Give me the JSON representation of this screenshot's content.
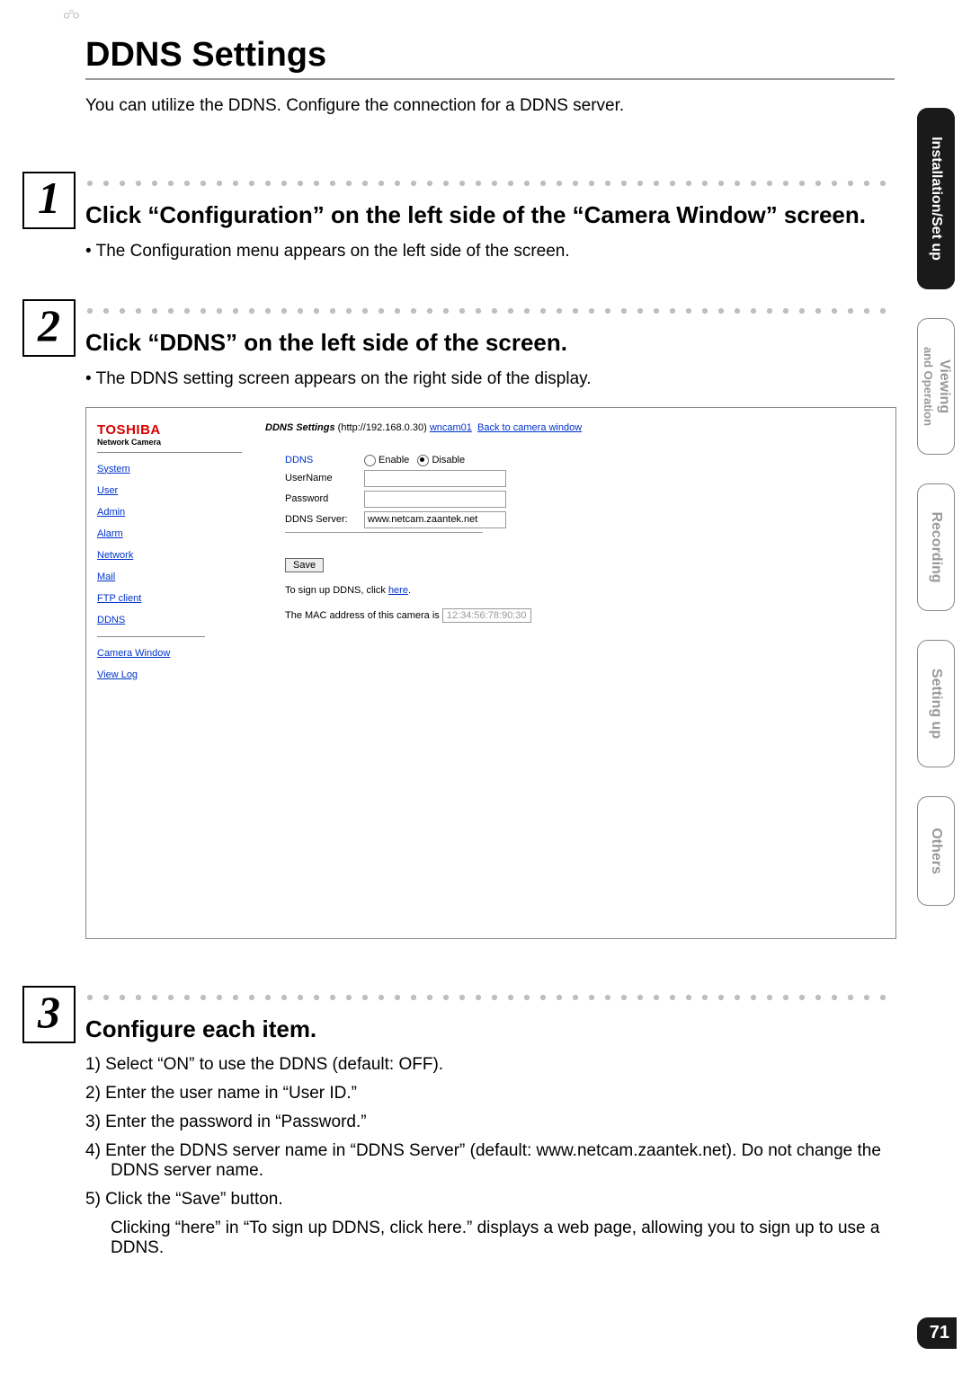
{
  "page_title": "DDNS Settings",
  "intro": "You can utilize the DDNS. Configure the connection for a DDNS server.",
  "page_number": "71",
  "side_tabs": {
    "t1": "Installation/Set up",
    "t2a": "Viewing",
    "t2b": "and Operation",
    "t3": "Recording",
    "t4": "Setting up",
    "t5": "Others"
  },
  "steps": {
    "s1": {
      "num": "1",
      "title": "Click “Configuration” on the left side of the “Camera Window” screen.",
      "bullet": "• The Configuration menu appears on the left side of the screen."
    },
    "s2": {
      "num": "2",
      "title": "Click “DDNS” on the left side of the screen.",
      "bullet": "• The DDNS setting screen appears on the right side of the display."
    },
    "s3": {
      "num": "3",
      "title": "Configure each item.",
      "i1": "1) Select “ON” to use the DDNS (default: OFF).",
      "i2": "2) Enter the user name in “User ID.”",
      "i3": "3) Enter the password in “Password.”",
      "i4": "4) Enter the DDNS server name in “DDNS Server” (default: www.netcam.zaantek.net). Do not change the DDNS server name.",
      "i5": "5) Click the “Save” button.",
      "note": "Clicking “here” in “To sign up DDNS, click here.” displays a web page, allowing you to sign up to use a DDNS."
    }
  },
  "screenshot": {
    "brand": "TOSHIBA",
    "brand_sub": "Network Camera",
    "nav": {
      "system": "System",
      "user": "User",
      "admin": "Admin",
      "alarm": "Alarm",
      "network": "Network",
      "mail": "Mail",
      "ftp": "FTP client",
      "ddns": "DDNS",
      "camera": "Camera Window",
      "viewlog": "View Log"
    },
    "header_bold": "DDNS Settings",
    "header_ip": " (http://192.168.0.30) ",
    "header_cam": "wncam01",
    "header_back": "Back to camera window",
    "form": {
      "ddns_label": "DDNS",
      "enable": "Enable",
      "disable": "Disable",
      "username_label": "UserName",
      "password_label": "Password",
      "server_label": "DDNS Server:",
      "server_value": "www.netcam.zaantek.net",
      "save": "Save",
      "signup_pre": "To sign up DDNS, click ",
      "signup_link": "here",
      "signup_post": ".",
      "mac_pre": "The MAC address of this camera is ",
      "mac_value": "12:34:56:78:90:30"
    }
  }
}
